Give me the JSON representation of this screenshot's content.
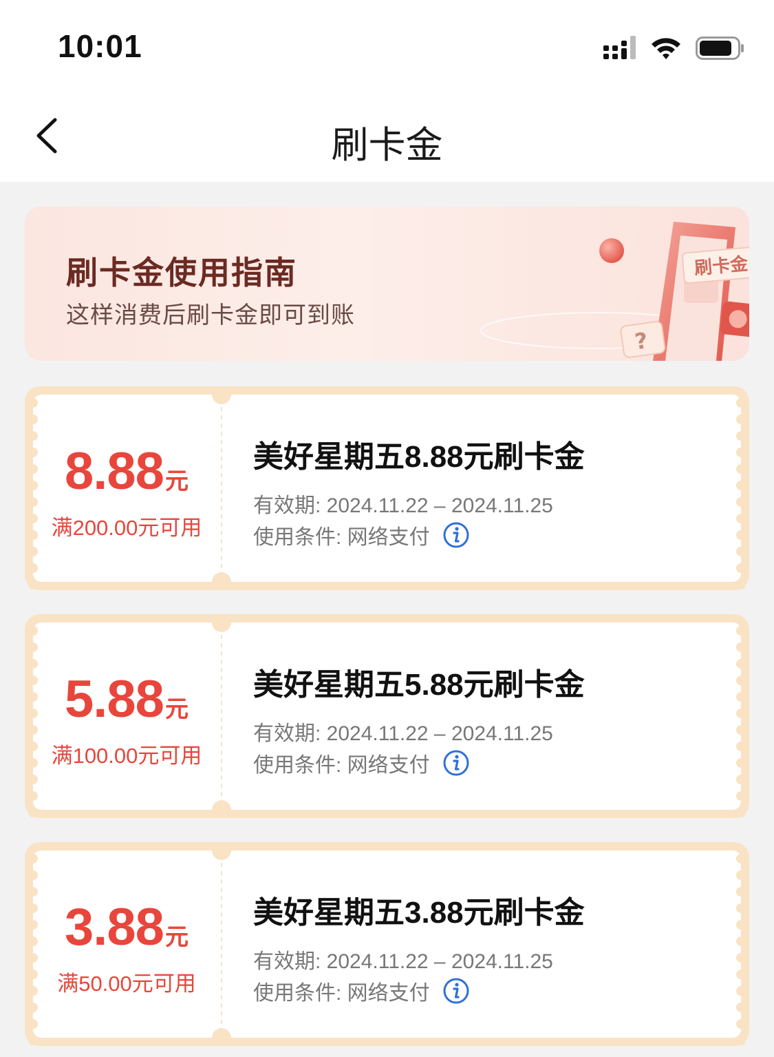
{
  "status_bar": {
    "time": "10:01"
  },
  "nav": {
    "title": "刷卡金"
  },
  "guide": {
    "title": "刷卡金使用指南",
    "subtitle": "这样消费后刷卡金即可到账",
    "card_text": "刷卡金"
  },
  "coupons": [
    {
      "amount": "8.88",
      "unit": "元",
      "threshold": "满200.00元可用",
      "title": "美好星期五8.88元刷卡金",
      "validity": "有效期: 2024.11.22 – 2024.11.25",
      "condition": "使用条件:  网络支付"
    },
    {
      "amount": "5.88",
      "unit": "元",
      "threshold": "满100.00元可用",
      "title": "美好星期五5.88元刷卡金",
      "validity": "有效期: 2024.11.22 – 2024.11.25",
      "condition": "使用条件:  网络支付"
    },
    {
      "amount": "3.88",
      "unit": "元",
      "threshold": "满50.00元可用",
      "title": "美好星期五3.88元刷卡金",
      "validity": "有效期: 2024.11.22 – 2024.11.25",
      "condition": "使用条件:  网络支付"
    }
  ],
  "colors": {
    "accent": "#e8463c",
    "coupon_border": "#f9e3c4",
    "info_blue": "#2f6fd6"
  },
  "icons": {
    "back": "chevron-left-icon",
    "signal": "signal-icon",
    "wifi": "wifi-icon",
    "battery": "battery-icon",
    "info": "info-icon"
  }
}
